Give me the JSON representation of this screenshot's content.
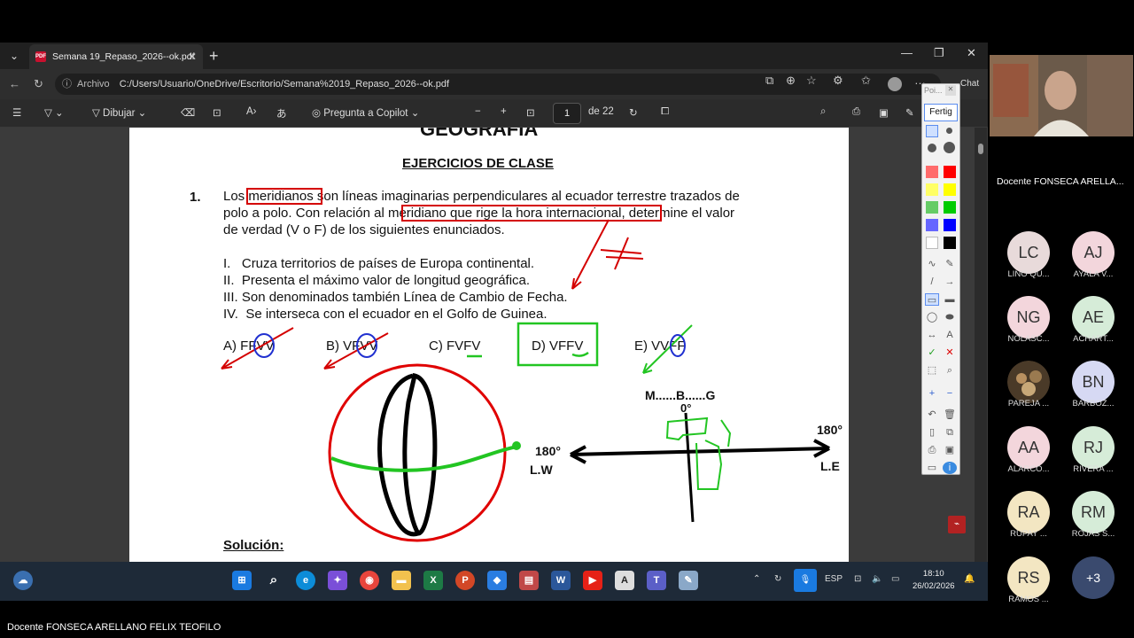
{
  "browser": {
    "tab_title": "Semana 19_Repaso_2026--ok.pdf",
    "address_label": "Archivo",
    "url": "C:/Users/Usuario/OneDrive/Escritorio/Semana%2019_Repaso_2026--ok.pdf",
    "chat_label": "Chat"
  },
  "pdf_toolbar": {
    "draw_label": "Dibujar",
    "copilot_label": "Pregunta a Copilot",
    "page_current": "1",
    "page_total_label": "de 22"
  },
  "document": {
    "heading_partial": "GEOGRAFÍA",
    "section_title": "EJERCICIOS DE CLASE",
    "question_number": "1.",
    "intro_line1_a": "Los ",
    "intro_line1_hl": "meridianos",
    "intro_line1_b": " son líneas imaginarias perpendiculares al ecuador terrestre trazados de",
    "intro_line2_a": "polo a polo. Con relación al ",
    "intro_line2_hl": "meridiano que rige la hora internacional,",
    "intro_line2_b": " determine el valor",
    "intro_line3": "de verdad (V o F) de los siguientes enunciados.",
    "statements": [
      {
        "num": "I.",
        "text": "Cruza territorios de países de Europa continental."
      },
      {
        "num": "II.",
        "text": "Presenta el máximo valor de longitud geográfica."
      },
      {
        "num": "III.",
        "text": "Son denominados también Línea de Cambio de Fecha."
      },
      {
        "num": "IV.",
        "text": "Se interseca con el ecuador en el Golfo de Guinea."
      }
    ],
    "options": [
      {
        "label": "A) FFVV"
      },
      {
        "label": "B) VFVV"
      },
      {
        "label": "C) FVFV"
      },
      {
        "label": "D) VFFV"
      },
      {
        "label": "E) VVFF"
      }
    ],
    "diagram_top_label": "M......B......G",
    "diagram_zero": "0°",
    "diagram_left_deg": "180°",
    "diagram_left_dir": "L.W",
    "diagram_right_deg": "180°",
    "diagram_right_dir": "L.E",
    "solution_label": "Solución:"
  },
  "ink_toolbar": {
    "title": "Poi...",
    "done_label": "Fertig",
    "colors": [
      "#ff6b6b",
      "#ff0000",
      "#ffff66",
      "#ffff00",
      "#66cc66",
      "#00cc00",
      "#6666ff",
      "#0000ff",
      "#ffffff",
      "#000000"
    ]
  },
  "taskbar": {
    "lang": "ESP",
    "time": "18:10",
    "date": "26/02/2026"
  },
  "meeting": {
    "presenter_name": "Docente FONSECA ARELLA...",
    "caption": "Docente FONSECA ARELLANO FELIX TEOFILO",
    "participants": [
      {
        "initials": "LC",
        "name": "LINO QU...",
        "color": "#e8dada"
      },
      {
        "initials": "AJ",
        "name": "AYALA V...",
        "color": "#f3d6dc"
      },
      {
        "initials": "NG",
        "name": "NOLASC...",
        "color": "#f3d6dc"
      },
      {
        "initials": "AE",
        "name": "ACHART...",
        "color": "#d6ecd8"
      },
      {
        "initials": "",
        "name": "PAREJA ...",
        "color": "#4a3a28"
      },
      {
        "initials": "BN",
        "name": "BARBOZ...",
        "color": "#d6d9f3"
      },
      {
        "initials": "AA",
        "name": "ALARCO...",
        "color": "#f3d6dc"
      },
      {
        "initials": "RJ",
        "name": "RIVERA ...",
        "color": "#d6ecd8"
      },
      {
        "initials": "RA",
        "name": "RUPAY ...",
        "color": "#f3e6c2"
      },
      {
        "initials": "RM",
        "name": "ROJAS S...",
        "color": "#d6ecd8"
      },
      {
        "initials": "RS",
        "name": "RAMOS ...",
        "color": "#f3e6c2"
      }
    ],
    "more_label": "+3"
  }
}
